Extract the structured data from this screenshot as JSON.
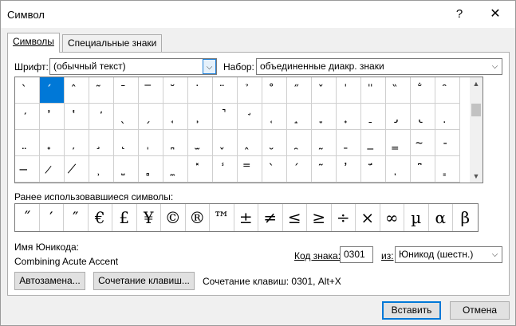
{
  "dialog": {
    "title": "Символ",
    "help": "?",
    "close": "✕"
  },
  "tabs": [
    {
      "label": "Символы"
    },
    {
      "label": "Специальные знаки"
    }
  ],
  "font": {
    "label": "Шрифт:",
    "value": "(обычный текст)"
  },
  "subset": {
    "label": "Набор:",
    "value": "объединенные диакр. знаки"
  },
  "grid": {
    "rows": [
      [
        "̀",
        "́",
        "̂",
        "̃",
        "̄",
        "̅",
        "̆",
        "̇",
        "̈",
        "̉",
        "̊",
        "̋",
        "̌",
        "̍",
        "̎",
        "̏",
        "̐",
        "̑"
      ],
      [
        "̒",
        "̓",
        "̔",
        "̕",
        "̖",
        "̗",
        "̘",
        "̙",
        "̚",
        "̛",
        "̜",
        "̝",
        "̞",
        "̟",
        "̠",
        "̡",
        "̢",
        "̣"
      ],
      [
        "̤",
        "̥",
        "̦",
        "̧",
        "̨",
        "̩",
        "̪",
        "̫",
        "̬",
        "̭",
        "̮",
        "̯",
        "̰",
        "̱",
        "̲",
        "̳",
        "̴",
        "̵"
      ],
      [
        "̶",
        "̷",
        "̸",
        "̹",
        "̺",
        "̻",
        "̼",
        "̽",
        "̾",
        "̿",
        "̀",
        "́",
        "͂",
        "̓",
        "̈́",
        "ͅ",
        "͆",
        "͇"
      ]
    ],
    "selected_index": 1
  },
  "recent": {
    "label": "Ранее использовавшиеся символы:",
    "symbols": [
      "˝",
      "′",
      "″",
      "€",
      "£",
      "¥",
      "©",
      "®",
      "™",
      "±",
      "≠",
      "≤",
      "≥",
      "÷",
      "×",
      "∞",
      "µ",
      "α",
      "β"
    ]
  },
  "unicode_name": {
    "label": "Имя Юникода:",
    "value": "Combining Acute Accent"
  },
  "char_code": {
    "label": "Код знака:",
    "value": "0301"
  },
  "from": {
    "label": "из:",
    "value": "Юникод (шестн.)"
  },
  "buttons": {
    "autocorrect": "Автозамена...",
    "shortcut_key": "Сочетание клавиш...",
    "insert": "Вставить",
    "cancel": "Отмена"
  },
  "shortcut_text": "Сочетание клавиш: 0301, Alt+X"
}
